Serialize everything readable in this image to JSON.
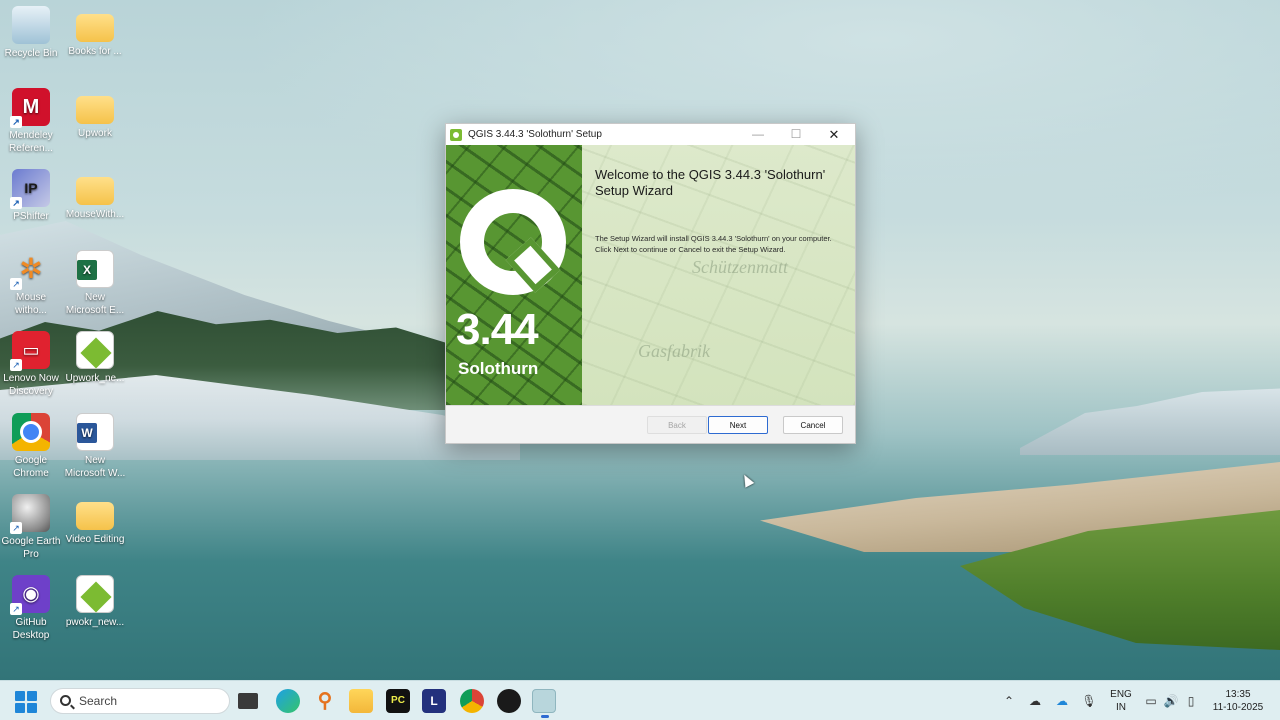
{
  "desktop": {
    "icons": [
      {
        "label": "Recycle Bin",
        "icon": "recycle-bin-icon"
      },
      {
        "label": "Books for ...",
        "icon": "folder-icon"
      },
      {
        "label": "Mendeley Referen...",
        "icon": "mendeley-icon"
      },
      {
        "label": "Upwork",
        "icon": "folder-icon"
      },
      {
        "label": "PShifter",
        "icon": "pshifter-icon"
      },
      {
        "label": "MouseWith...",
        "icon": "folder-icon"
      },
      {
        "label": "Mouse witho...",
        "icon": "mouse-without-borders-icon"
      },
      {
        "label": "New Microsoft E...",
        "icon": "excel-file-icon"
      },
      {
        "label": "Lenovo Now Discovery",
        "icon": "lenovo-now-icon"
      },
      {
        "label": "Upwork_ne...",
        "icon": "qgis-file-icon"
      },
      {
        "label": "Google Chrome",
        "icon": "chrome-icon"
      },
      {
        "label": "New Microsoft W...",
        "icon": "word-file-icon"
      },
      {
        "label": "Google Earth Pro",
        "icon": "google-earth-icon"
      },
      {
        "label": "Video Editing",
        "icon": "folder-icon"
      },
      {
        "label": "GitHub Desktop",
        "icon": "github-desktop-icon"
      },
      {
        "label": "pwokr_new...",
        "icon": "qgis-file-icon"
      }
    ]
  },
  "dialog": {
    "title": "QGIS 3.44.3 'Solothurn' Setup",
    "banner_version": "3.44",
    "banner_codename": "Solothurn",
    "heading": "Welcome to the QGIS 3.44.3 'Solothurn' Setup Wizard",
    "description": "The Setup Wizard will install QGIS 3.44.3 'Solothurn' on your computer. Click Next to continue or Cancel to exit the Setup Wizard.",
    "map_labels": [
      "Schützenmatt",
      "Gasfabrik"
    ],
    "buttons": {
      "back": "Back",
      "next": "Next",
      "cancel": "Cancel"
    },
    "back_enabled": false,
    "accent_color": "#589632"
  },
  "taskbar": {
    "search_placeholder": "Search",
    "apps": [
      "task-view-icon",
      "edge-icon",
      "search-tool-icon",
      "file-explorer-icon",
      "pycharm-icon",
      "l-app-icon",
      "chrome-icon",
      "media-app-icon",
      "qgis-setup-icon"
    ],
    "tray": {
      "language_line1": "ENG",
      "language_line2": "IN",
      "time": "13:35",
      "date": "11-10-2025"
    }
  }
}
